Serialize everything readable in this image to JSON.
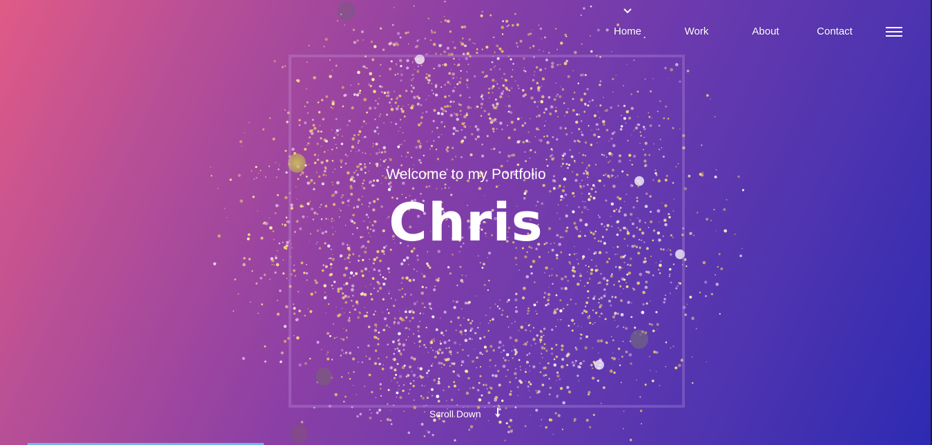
{
  "nav": {
    "items": [
      {
        "label": "Home",
        "active": true
      },
      {
        "label": "Work",
        "active": false
      },
      {
        "label": "About",
        "active": false
      },
      {
        "label": "Contact",
        "active": false
      }
    ],
    "menu_icon": "hamburger-menu-icon",
    "active_indicator_icon": "chevron-down-icon"
  },
  "hero": {
    "subtitle": "Welcome to my Portfolio",
    "title": "Chris",
    "scroll_label": "Scroll Down",
    "scroll_icon": "arrow-down-icon"
  },
  "colors": {
    "gradient_start": "#e05a86",
    "gradient_mid": "#8a3fa6",
    "gradient_end": "#2d2ab2",
    "glitter_gold": "#f3d37a",
    "text": "#ffffff"
  }
}
